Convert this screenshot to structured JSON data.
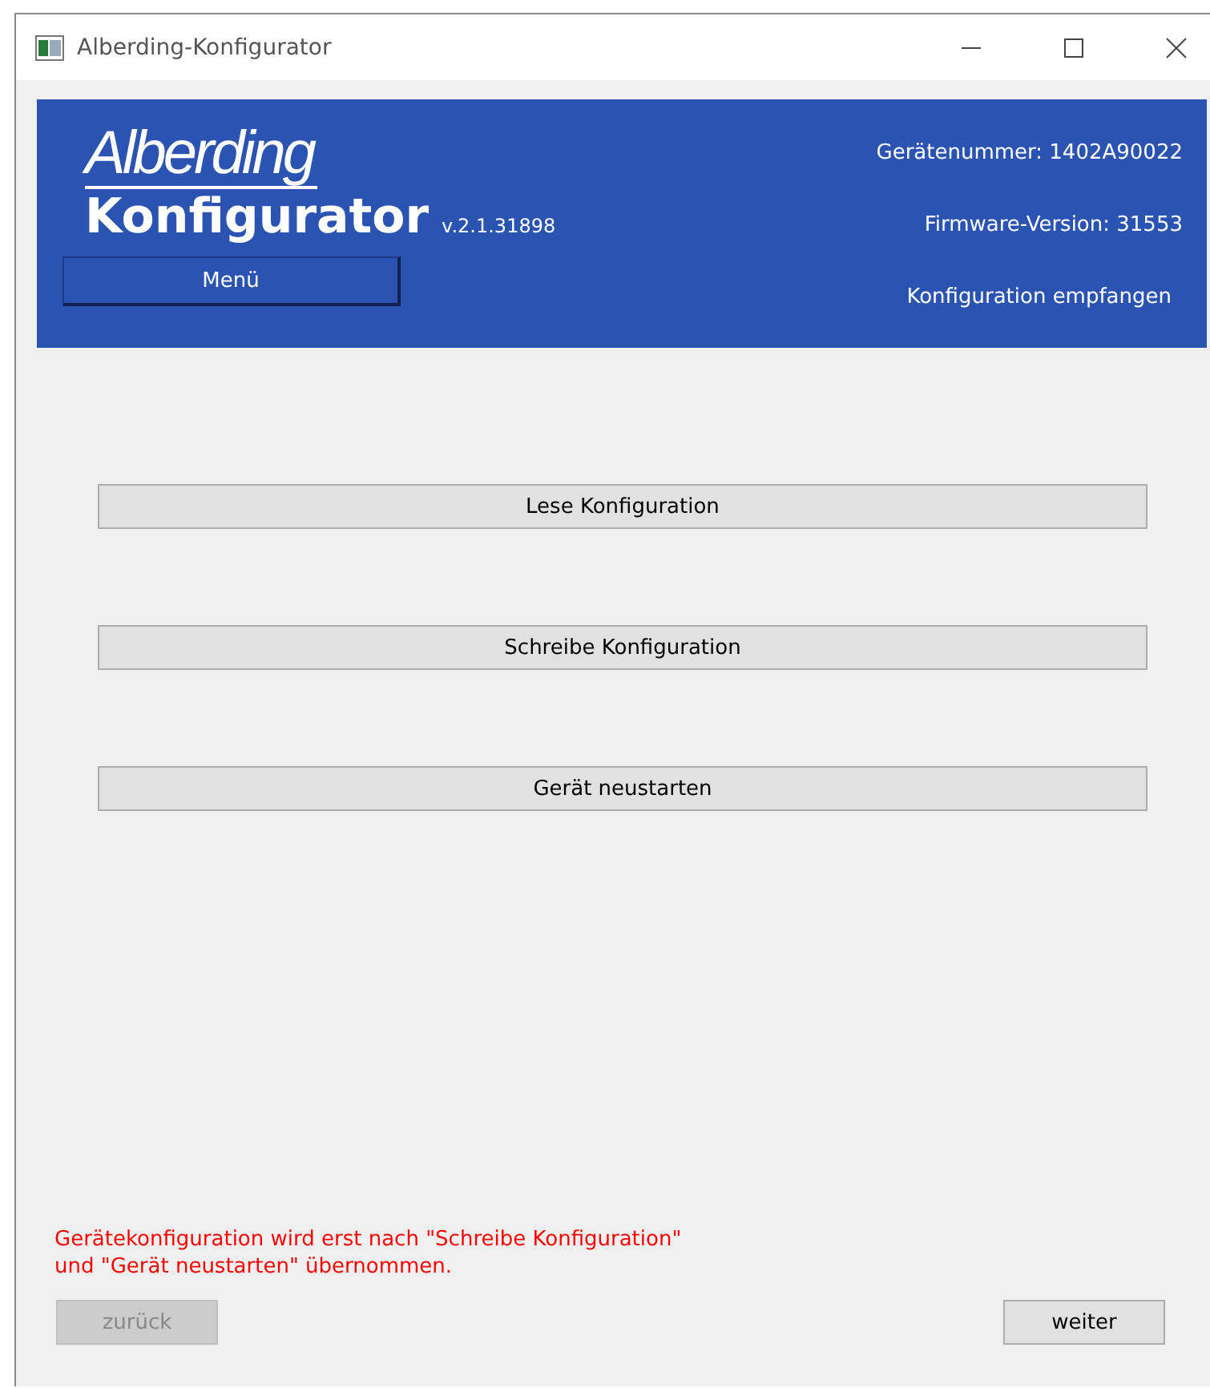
{
  "window": {
    "title": "Alberding-Konfigurator"
  },
  "header": {
    "logo": "Alberding",
    "title": "Konfigurator",
    "version": "v.2.1.31898",
    "menu_button": "Menü",
    "device_number": "Gerätenummer: 1402A90022",
    "firmware": "Firmware-Version: 31553",
    "status": "Konfiguration empfangen"
  },
  "actions": [
    {
      "label": "Lese Konfiguration"
    },
    {
      "label": "Schreibe Konfiguration"
    },
    {
      "label": "Gerät neustarten"
    }
  ],
  "note": "Gerätekonfiguration wird erst nach \"Schreibe Konfiguration\" und \"Gerät neustarten\" übernommen.",
  "nav": {
    "back": {
      "label": "zurück",
      "disabled": true
    },
    "next": {
      "label": "weiter",
      "disabled": false
    }
  }
}
